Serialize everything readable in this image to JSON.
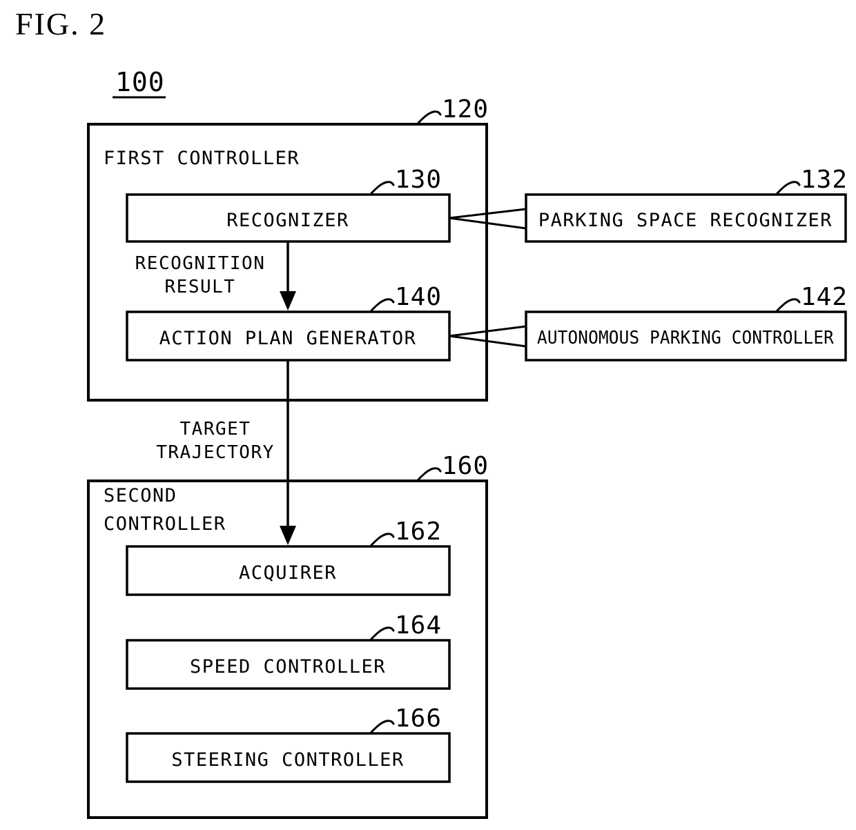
{
  "figure": {
    "title": "FIG. 2",
    "system_ref": "100"
  },
  "blocks": {
    "first_controller": {
      "label": "FIRST CONTROLLER",
      "ref": "120"
    },
    "recognizer": {
      "label": "RECOGNIZER",
      "ref": "130"
    },
    "parking_space_recognizer": {
      "label": "PARKING SPACE RECOGNIZER",
      "ref": "132"
    },
    "action_plan_generator": {
      "label": "ACTION PLAN GENERATOR",
      "ref": "140"
    },
    "autonomous_parking_controller": {
      "label": "AUTONOMOUS PARKING CONTROLLER",
      "ref": "142"
    },
    "second_controller": {
      "label_line1": "SECOND",
      "label_line2": "CONTROLLER",
      "ref": "160"
    },
    "acquirer": {
      "label": "ACQUIRER",
      "ref": "162"
    },
    "speed_controller": {
      "label": "SPEED CONTROLLER",
      "ref": "164"
    },
    "steering_controller": {
      "label": "STEERING CONTROLLER",
      "ref": "166"
    }
  },
  "flows": {
    "recognition_result": {
      "line1": "RECOGNITION",
      "line2": "RESULT"
    },
    "target_trajectory": {
      "line1": "TARGET",
      "line2": "TRAJECTORY"
    }
  },
  "colors": {
    "ink": "#000000",
    "paper": "#ffffff"
  }
}
